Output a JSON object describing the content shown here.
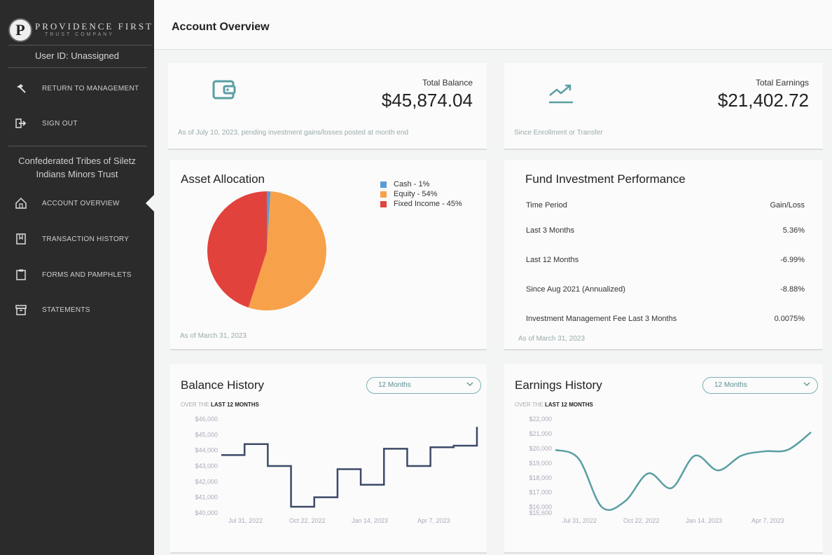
{
  "sidebar": {
    "brand": {
      "name": "PROVIDENCE FIRST",
      "sub": "TRUST COMPANY",
      "mark": "P"
    },
    "user_id": "User ID: Unassigned",
    "top_items": [
      {
        "label": "RETURN TO MANAGEMENT",
        "icon": "hammer-icon"
      },
      {
        "label": "SIGN OUT",
        "icon": "sign-out-icon"
      }
    ],
    "org_name": "Confederated Tribes of Siletz Indians Minors Trust",
    "items": [
      {
        "label": "ACCOUNT OVERVIEW",
        "icon": "home-icon",
        "active": true
      },
      {
        "label": "TRANSACTION HISTORY",
        "icon": "book-icon"
      },
      {
        "label": "FORMS AND PAMPHLETS",
        "icon": "clipboard-icon"
      },
      {
        "label": "STATEMENTS",
        "icon": "archive-icon"
      }
    ]
  },
  "header": {
    "title": "Account Overview"
  },
  "balance": {
    "label": "Total Balance",
    "value": "$45,874.04",
    "note": "As of July 10, 2023, pending investment gains/losses posted at month end",
    "icon": "wallet-icon"
  },
  "earnings": {
    "label": "Total Earnings",
    "value": "$21,402.72",
    "note": "Since Enrollment or Transfer",
    "icon": "trend-up-icon"
  },
  "allocation": {
    "title": "Asset Allocation",
    "asof": "As of March 31, 2023",
    "legend": [
      {
        "label": "Cash - 1%",
        "color": "#5b9bd5"
      },
      {
        "label": "Equity - 54%",
        "color": "#f7a14a"
      },
      {
        "label": "Fixed Income - 45%",
        "color": "#e2423c"
      }
    ]
  },
  "performance": {
    "title": "Fund Investment Performance",
    "headers": [
      "Time Period",
      "Gain/Loss"
    ],
    "rows": [
      {
        "period": "Last 3 Months",
        "value": "5.36%"
      },
      {
        "period": "Last 12 Months",
        "value": "-6.99%"
      },
      {
        "period": "Since Aug 2021 (Annualized)",
        "value": "-8.88%"
      },
      {
        "period": "Investment Management Fee Last 3 Months",
        "value": "0.0075%"
      }
    ],
    "asof": "As of March 31, 2023"
  },
  "balance_history": {
    "title": "Balance History",
    "select": "12 Months",
    "over_prefix": "OVER THE",
    "over_bold": "LAST 12 MONTHS"
  },
  "earnings_history": {
    "title": "Earnings History",
    "select": "12 Months",
    "over_prefix": "OVER THE",
    "over_bold": "LAST 12 MONTHS"
  },
  "colors": {
    "accent": "#5a9ea3",
    "sidebar": "#2b2b2b",
    "step_line": "#3c4a68"
  },
  "chart_data": [
    {
      "type": "pie",
      "categories": [
        "Cash",
        "Equity",
        "Fixed Income"
      ],
      "values": [
        1,
        54,
        45
      ],
      "colors": [
        "#5b9bd5",
        "#f7a14a",
        "#e2423c"
      ],
      "title": "Asset Allocation",
      "legend": "right"
    },
    {
      "type": "line",
      "title": "Balance History",
      "step": true,
      "x_ticks": [
        "Jul 31, 2022",
        "Oct 22, 2022",
        "Jan 14, 2023",
        "Apr 7, 2023"
      ],
      "y_ticks": [
        "$40,000",
        "$41,000",
        "$42,000",
        "$43,000",
        "$44,000",
        "$45,000",
        "$46,000"
      ],
      "ylim": [
        40000,
        46000
      ],
      "series": [
        {
          "values": [
            43700,
            44400,
            43000,
            40400,
            41000,
            42800,
            41800,
            44100,
            43000,
            44200,
            44300,
            45500
          ]
        }
      ],
      "grid": false
    },
    {
      "type": "line",
      "title": "Earnings History",
      "x_ticks": [
        "Jul 31, 2022",
        "Oct 22, 2022",
        "Jan 14, 2023",
        "Apr 7, 2023"
      ],
      "y_ticks": [
        "$15,600",
        "$16,000",
        "$17,000",
        "$18,000",
        "$19,000",
        "$20,000",
        "$21,000",
        "$22,000"
      ],
      "ylim": [
        15600,
        22000
      ],
      "series": [
        {
          "values": [
            19900,
            19300,
            16000,
            16400,
            18300,
            17300,
            19500,
            18500,
            19500,
            19800,
            19900,
            21100
          ]
        }
      ],
      "grid": false
    }
  ]
}
